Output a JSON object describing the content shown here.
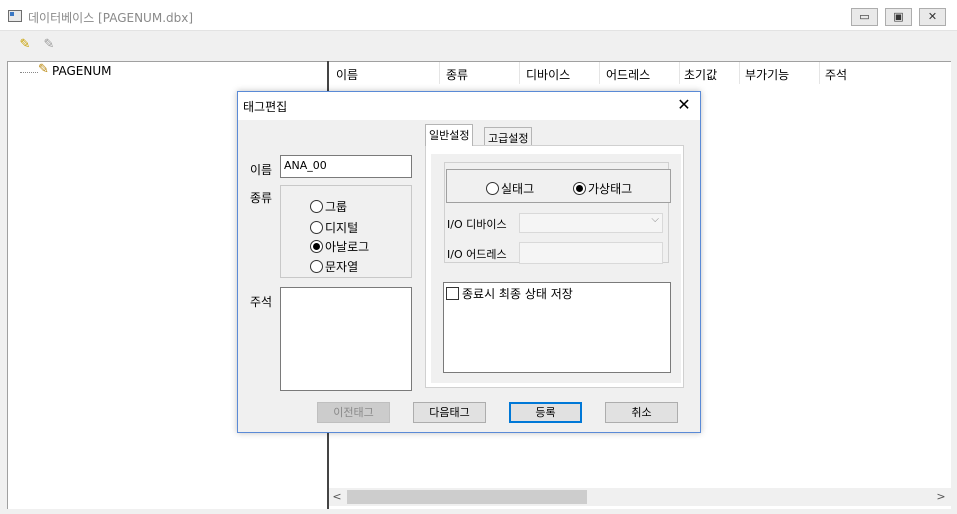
{
  "window": {
    "title": "데이터베이스 [PAGENUM.dbx]",
    "minimize_glyph": "▭",
    "maximize_glyph": "▣",
    "close_glyph": "✕"
  },
  "toolbar": {
    "icons": [
      "tag-add-icon",
      "tag-delete-icon"
    ]
  },
  "tree": {
    "root_label": "PAGENUM"
  },
  "list": {
    "columns": [
      "이름",
      "종류",
      "디바이스",
      "어드레스",
      "초기값",
      "부가기능",
      "주석"
    ],
    "scroll_left": "<",
    "scroll_right": ">"
  },
  "dialog": {
    "title": "태그편집",
    "close_glyph": "✕",
    "name_label": "이름",
    "name_value": "ANA_00",
    "type_label": "종류",
    "type_options": [
      "그룹",
      "디지털",
      "아날로그",
      "문자열"
    ],
    "type_selected": "아날로그",
    "comment_label": "주석",
    "tabs": [
      "일반설정",
      "고급설정"
    ],
    "active_tab": "일반설정",
    "real_tag_label": "실태그",
    "virtual_tag_label": "가상태그",
    "tag_mode_selected": "가상태그",
    "io_device_label": "I/O 디바이스",
    "io_address_label": "I/O 어드레스",
    "save_on_exit_label": "종료시 최종 상태 저장",
    "save_on_exit_checked": false,
    "buttons": {
      "prev": "이전태그",
      "next": "다음태그",
      "register": "등록",
      "cancel": "취소"
    }
  }
}
